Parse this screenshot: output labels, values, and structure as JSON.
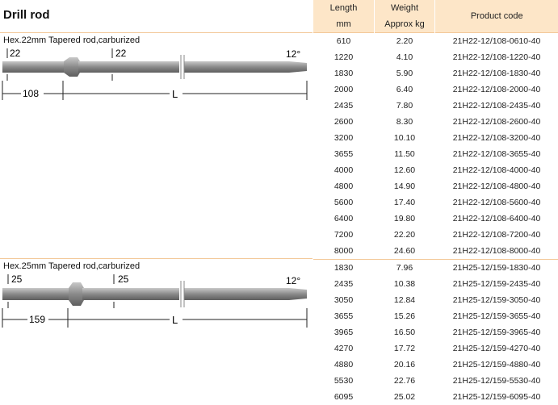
{
  "title": "Drill rod",
  "table": {
    "headers": {
      "length": "Length",
      "length_unit": "mm",
      "weight": "Weight",
      "weight_unit": "Approx kg",
      "product_code": "Product code"
    },
    "groups": [
      {
        "rows": [
          {
            "length": "610",
            "weight": "2.20",
            "code": "21H22-12/108-0610-40"
          },
          {
            "length": "1220",
            "weight": "4.10",
            "code": "21H22-12/108-1220-40"
          },
          {
            "length": "1830",
            "weight": "5.90",
            "code": "21H22-12/108-1830-40"
          },
          {
            "length": "2000",
            "weight": "6.40",
            "code": "21H22-12/108-2000-40"
          },
          {
            "length": "2435",
            "weight": "7.80",
            "code": "21H22-12/108-2435-40"
          },
          {
            "length": "2600",
            "weight": "8.30",
            "code": "21H22-12/108-2600-40"
          },
          {
            "length": "3200",
            "weight": "10.10",
            "code": "21H22-12/108-3200-40"
          },
          {
            "length": "3655",
            "weight": "11.50",
            "code": "21H22-12/108-3655-40"
          },
          {
            "length": "4000",
            "weight": "12.60",
            "code": "21H22-12/108-4000-40"
          },
          {
            "length": "4800",
            "weight": "14.90",
            "code": "21H22-12/108-4800-40"
          },
          {
            "length": "5600",
            "weight": "17.40",
            "code": "21H22-12/108-5600-40"
          },
          {
            "length": "6400",
            "weight": "19.80",
            "code": "21H22-12/108-6400-40"
          },
          {
            "length": "7200",
            "weight": "22.20",
            "code": "21H22-12/108-7200-40"
          },
          {
            "length": "8000",
            "weight": "24.60",
            "code": "21H22-12/108-8000-40"
          }
        ]
      },
      {
        "rows": [
          {
            "length": "1830",
            "weight": "7.96",
            "code": "21H25-12/159-1830-40"
          },
          {
            "length": "2435",
            "weight": "10.38",
            "code": "21H25-12/159-2435-40"
          },
          {
            "length": "3050",
            "weight": "12.84",
            "code": "21H25-12/159-3050-40"
          },
          {
            "length": "3655",
            "weight": "15.26",
            "code": "21H25-12/159-3655-40"
          },
          {
            "length": "3965",
            "weight": "16.50",
            "code": "21H25-12/159-3965-40"
          },
          {
            "length": "4270",
            "weight": "17.72",
            "code": "21H25-12/159-4270-40"
          },
          {
            "length": "4880",
            "weight": "20.16",
            "code": "21H25-12/159-4880-40"
          },
          {
            "length": "5530",
            "weight": "22.76",
            "code": "21H25-12/159-5530-40"
          },
          {
            "length": "6095",
            "weight": "25.02",
            "code": "21H25-12/159-6095-40"
          }
        ]
      }
    ]
  },
  "sections": [
    {
      "label": "Hex.22mm Tapered rod,carburized",
      "hex_dim": "22",
      "collar_dim": "22",
      "shank_len": "108",
      "length_symbol": "L",
      "taper": "12°"
    },
    {
      "label": "Hex.25mm Tapered rod,carburized",
      "hex_dim": "25",
      "collar_dim": "25",
      "shank_len": "159",
      "length_symbol": "L",
      "taper": "12°"
    }
  ],
  "colors": {
    "header_bg": "#fde6c8",
    "rule": "#f3c99a",
    "rod": "#8a8a8a"
  }
}
